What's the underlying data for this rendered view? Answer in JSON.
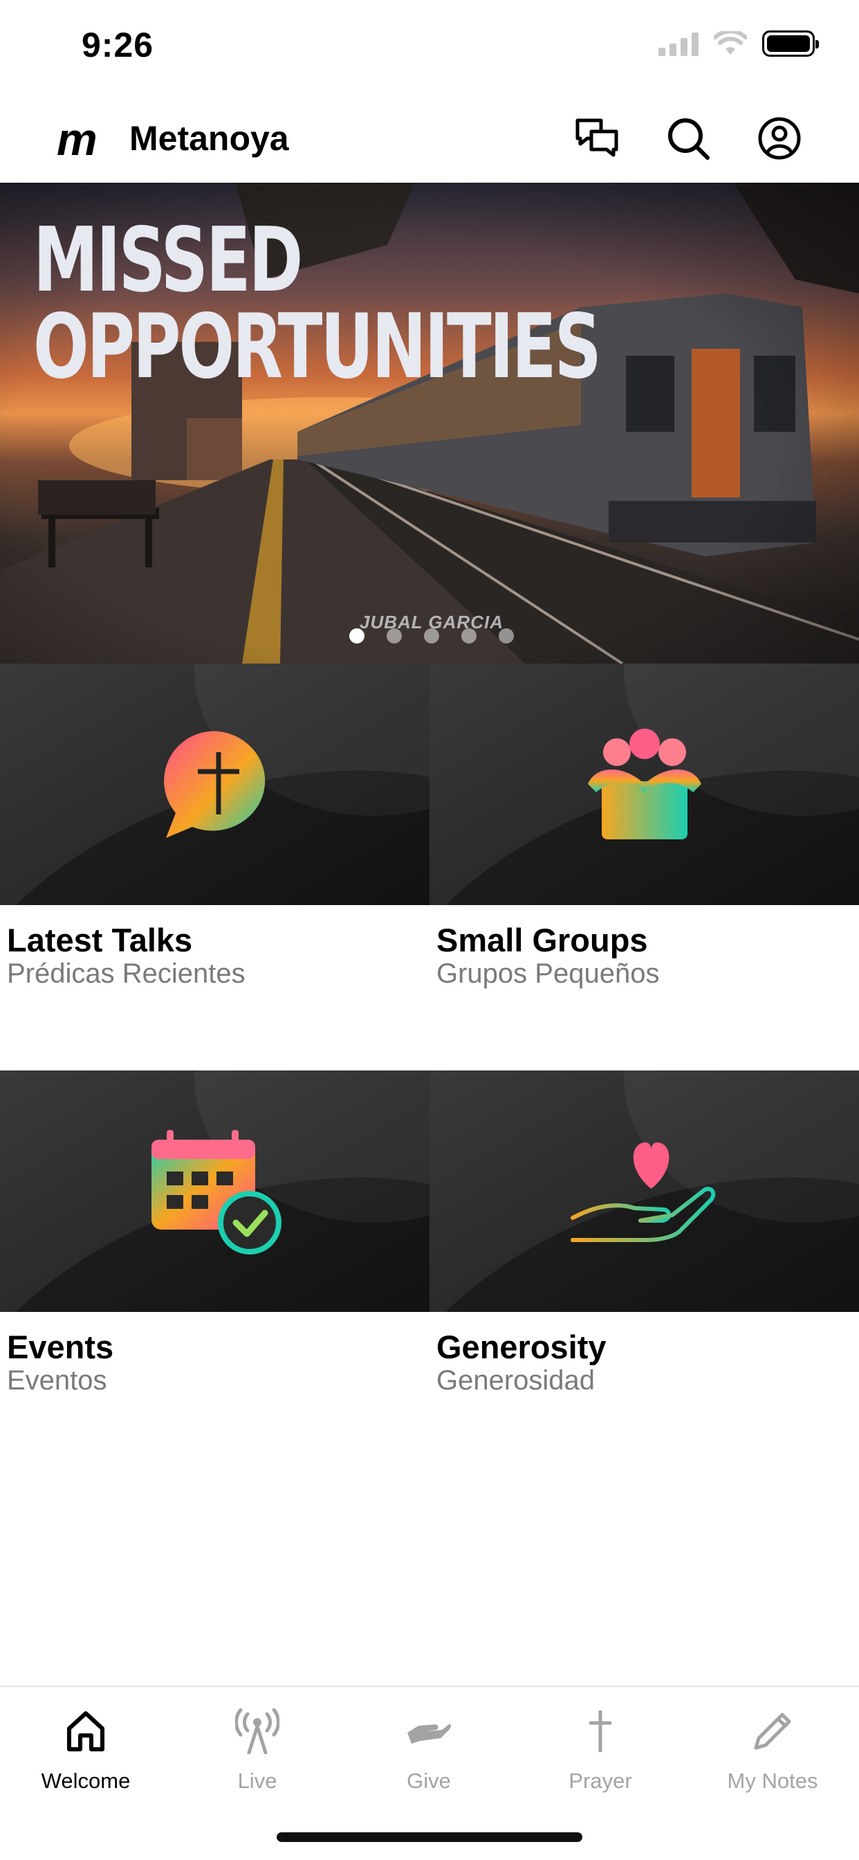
{
  "status": {
    "time": "9:26"
  },
  "header": {
    "logo": "m",
    "title": "Metanoya"
  },
  "banner": {
    "title_line1": "Missed",
    "title_line2": "Opportunities",
    "credit": "JUBAL GARCIA",
    "slide_count": 5,
    "active_slide": 1
  },
  "tiles": [
    {
      "title": "Latest Talks",
      "subtitle": "Prédicas Recientes",
      "icon": "chat-cross-icon"
    },
    {
      "title": "Small Groups",
      "subtitle": "Grupos Pequeños",
      "icon": "group-hug-icon"
    },
    {
      "title": "Events",
      "subtitle": "Eventos",
      "icon": "calendar-check-icon"
    },
    {
      "title": "Generosity",
      "subtitle": "Generosidad",
      "icon": "heart-hand-icon"
    }
  ],
  "tabs": [
    {
      "label": "Welcome",
      "icon": "home-icon",
      "active": true
    },
    {
      "label": "Live",
      "icon": "broadcast-icon",
      "active": false
    },
    {
      "label": "Give",
      "icon": "give-hand-icon",
      "active": false
    },
    {
      "label": "Prayer",
      "icon": "cross-icon",
      "active": false
    },
    {
      "label": "My Notes",
      "icon": "pencil-icon",
      "active": false
    }
  ],
  "colors": {
    "accent_gradient": [
      "#ff4f8b",
      "#f6a623",
      "#1ccfb0"
    ],
    "tab_inactive": "#a3a3a3"
  }
}
